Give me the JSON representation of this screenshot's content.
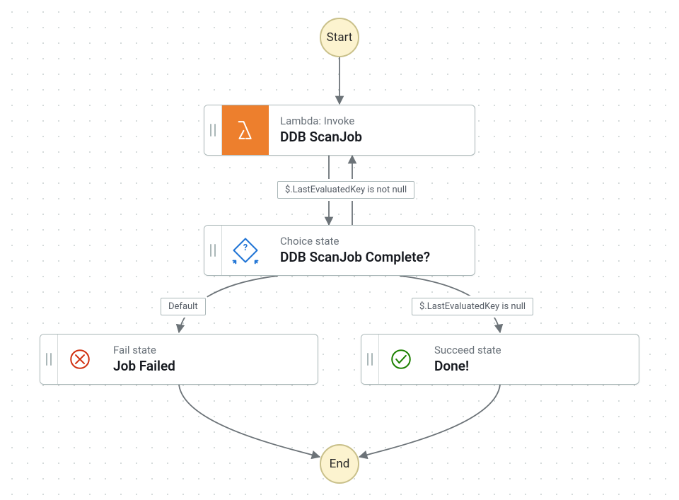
{
  "terminals": {
    "start": "Start",
    "end": "End"
  },
  "nodes": {
    "lambda": {
      "type": "Lambda: Invoke",
      "title": "DDB ScanJob"
    },
    "choice": {
      "type": "Choice state",
      "title": "DDB ScanJob Complete?"
    },
    "fail": {
      "type": "Fail state",
      "title": "Job Failed"
    },
    "succeed": {
      "type": "Succeed state",
      "title": "Done!"
    }
  },
  "edges": {
    "loop_back": "$.LastEvaluatedKey is not null",
    "to_fail": "Default",
    "to_succeed": "$.LastEvaluatedKey is null"
  },
  "colors": {
    "lambda_bg": "#ed7f2d",
    "choice_stroke": "#2074d5",
    "fail_stroke": "#d13212",
    "succeed_stroke": "#1d8102"
  }
}
